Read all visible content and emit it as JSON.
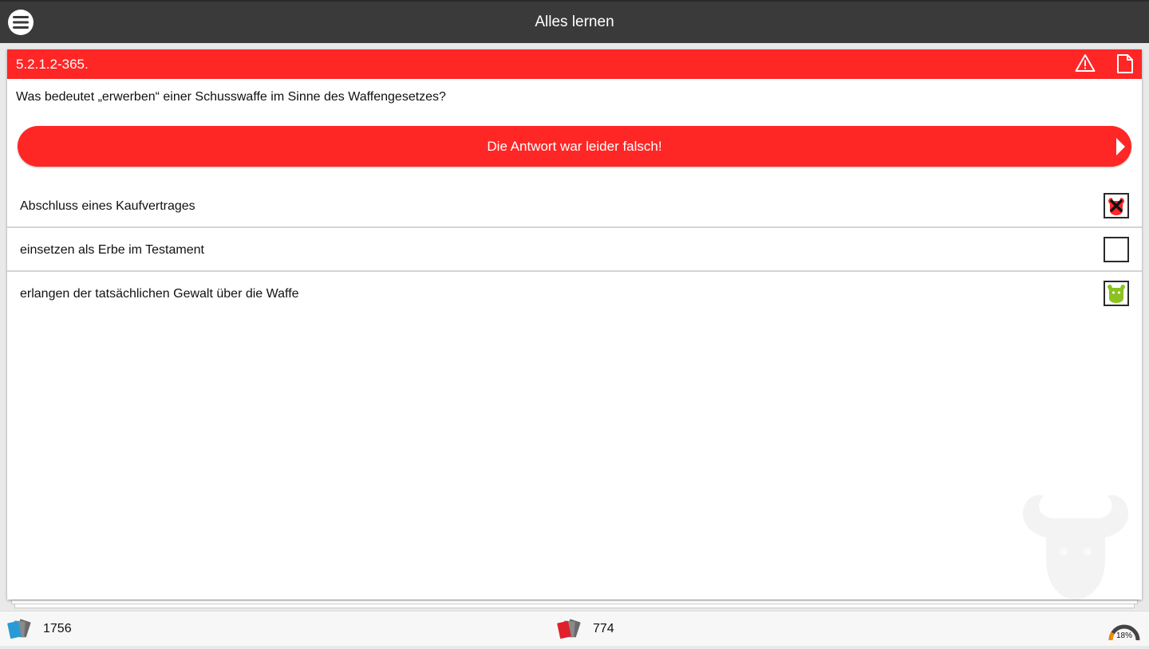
{
  "header": {
    "title": "Alles lernen"
  },
  "card": {
    "question_id": "5.2.1.2-365.",
    "question": "Was bedeutet „erwerben“ einer Schusswaffe im Sinne des Waffengesetzes?",
    "result": "Die Antwort war leider falsch!",
    "answers": [
      {
        "text": "Abschluss eines Kaufvertrages",
        "state": "wrong-selected"
      },
      {
        "text": "einsetzen als Erbe im Testament",
        "state": "unchecked"
      },
      {
        "text": "erlangen der tatsächlichen Gewalt über die Waffe",
        "state": "correct"
      }
    ]
  },
  "footer": {
    "total_count": "1756",
    "wrong_count": "774",
    "progress_label": "18%",
    "progress_fraction": 0.18
  },
  "colors": {
    "accent_red": "#ff2626",
    "topbar": "#3a3a3a",
    "correct_green": "#8cc21f"
  },
  "icons": {
    "menu": "menu-icon",
    "warning": "warning-icon",
    "document": "document-icon",
    "arrow": "arrow-right-icon",
    "cards": "cards-icon",
    "wrong_cards": "wrong-cards-icon",
    "gauge": "progress-gauge-icon",
    "mascot": "buffalo-icon"
  }
}
